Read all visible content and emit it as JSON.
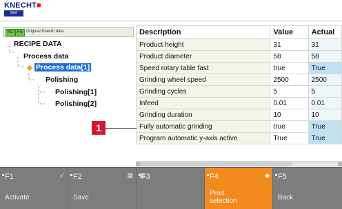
{
  "brand": {
    "name": "KNECHT",
    "dot": "■",
    "badge": "text"
  },
  "leftbar": {
    "chip_nc": "NC",
    "chip_fix": "Fix",
    "text": "Original Knecht data"
  },
  "tree": {
    "items": [
      {
        "label": "RECIPE DATA"
      },
      {
        "label": "Process data"
      },
      {
        "label": "Process data[1]"
      },
      {
        "label": "Polishing"
      },
      {
        "label": "Polishing[1]"
      },
      {
        "label": "Polishing[2]"
      }
    ]
  },
  "table": {
    "headers": [
      "Description",
      "Value",
      "Actual"
    ],
    "rows": [
      {
        "description": "Product height",
        "value": "31",
        "actual": "31"
      },
      {
        "description": "Product diameter",
        "value": "58",
        "actual": "58"
      },
      {
        "description": "Speed rotary table fast",
        "value": "true",
        "actual": "True"
      },
      {
        "description": "Grinding wheel speed",
        "value": "2500",
        "actual": "2500"
      },
      {
        "description": "Grinding cycles",
        "value": "5",
        "actual": "5"
      },
      {
        "description": "Infeed",
        "value": "0.01",
        "actual": "0.01"
      },
      {
        "description": "Grinding duration",
        "value": "10",
        "actual": "10"
      },
      {
        "description": "Fully automatic grinding",
        "value": "true",
        "actual": "True"
      },
      {
        "description": "Program automatic y-axis active",
        "value": "True",
        "actual": "True"
      }
    ]
  },
  "callout": {
    "number": "1"
  },
  "softkeys": [
    {
      "fkey": "F1",
      "label": "Activate",
      "icon": "✓"
    },
    {
      "fkey": "F2",
      "label": "Save",
      "icon": "▦"
    },
    {
      "fkey": "F3",
      "label": "",
      "icon": "▦"
    },
    {
      "fkey": "F4",
      "label_line1": "Prod.",
      "label_line2": "selection",
      "icon": "◆"
    },
    {
      "fkey": "F5",
      "label": "Back",
      "icon": ""
    }
  ],
  "colors": {
    "accent": "#f28a1d",
    "selection": "#1f6fd3",
    "callout": "#d4172c"
  }
}
